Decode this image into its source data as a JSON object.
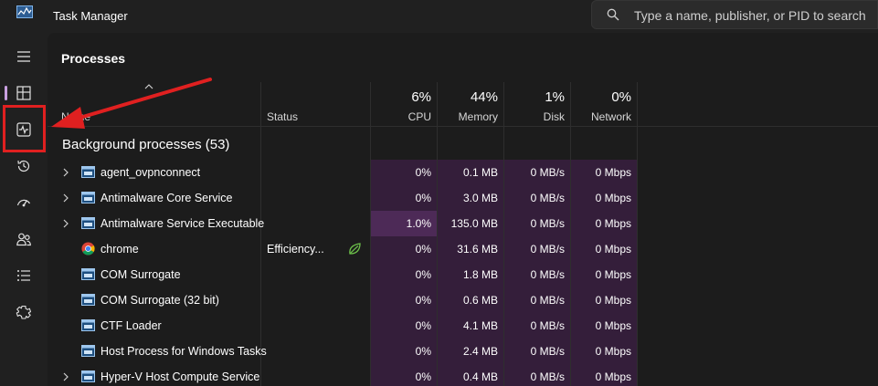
{
  "window": {
    "title": "Task Manager",
    "search_placeholder": "Type a name, publisher, or PID to search"
  },
  "sidebar": {
    "items": [
      {
        "icon": "hamburger-icon"
      },
      {
        "icon": "processes-icon",
        "active": true
      },
      {
        "icon": "performance-icon",
        "highlighted": true
      },
      {
        "icon": "app-history-icon"
      },
      {
        "icon": "startup-apps-icon"
      },
      {
        "icon": "users-icon"
      },
      {
        "icon": "details-icon"
      },
      {
        "icon": "services-icon"
      }
    ]
  },
  "page": {
    "title": "Processes"
  },
  "columns": {
    "name": "Name",
    "status": "Status",
    "cpu": {
      "pct": "6%",
      "label": "CPU"
    },
    "memory": {
      "pct": "44%",
      "label": "Memory"
    },
    "disk": {
      "pct": "1%",
      "label": "Disk"
    },
    "network": {
      "pct": "0%",
      "label": "Network"
    }
  },
  "group": {
    "title": "Background processes (53)"
  },
  "rows": [
    {
      "name": "agent_ovpnconnect",
      "status": "",
      "cpu": "0%",
      "memory": "0.1 MB",
      "disk": "0 MB/s",
      "network": "0 Mbps",
      "expandable": true,
      "icon": "window-icon"
    },
    {
      "name": "Antimalware Core Service",
      "status": "",
      "cpu": "0%",
      "memory": "3.0 MB",
      "disk": "0 MB/s",
      "network": "0 Mbps",
      "expandable": true,
      "icon": "window-icon"
    },
    {
      "name": "Antimalware Service Executable",
      "status": "",
      "cpu": "1.0%",
      "memory": "135.0 MB",
      "disk": "0 MB/s",
      "network": "0 Mbps",
      "expandable": true,
      "icon": "window-icon"
    },
    {
      "name": "chrome",
      "status": "Efficiency...",
      "cpu": "0%",
      "memory": "31.6 MB",
      "disk": "0 MB/s",
      "network": "0 Mbps",
      "expandable": false,
      "icon": "chrome-icon",
      "efficiency": true
    },
    {
      "name": "COM Surrogate",
      "status": "",
      "cpu": "0%",
      "memory": "1.8 MB",
      "disk": "0 MB/s",
      "network": "0 Mbps",
      "expandable": false,
      "icon": "window-icon"
    },
    {
      "name": "COM Surrogate (32 bit)",
      "status": "",
      "cpu": "0%",
      "memory": "0.6 MB",
      "disk": "0 MB/s",
      "network": "0 Mbps",
      "expandable": false,
      "icon": "window-icon"
    },
    {
      "name": "CTF Loader",
      "status": "",
      "cpu": "0%",
      "memory": "4.1 MB",
      "disk": "0 MB/s",
      "network": "0 Mbps",
      "expandable": false,
      "icon": "window-icon"
    },
    {
      "name": "Host Process for Windows Tasks",
      "status": "",
      "cpu": "0%",
      "memory": "2.4 MB",
      "disk": "0 MB/s",
      "network": "0 Mbps",
      "expandable": false,
      "icon": "window-icon"
    },
    {
      "name": "Hyper-V Host Compute Service",
      "status": "",
      "cpu": "0%",
      "memory": "0.4 MB",
      "disk": "0 MB/s",
      "network": "0 Mbps",
      "expandable": true,
      "icon": "window-icon"
    }
  ],
  "colors": {
    "background": "#202020",
    "panel": "#1c1c1c",
    "heat_low": "#341e3a",
    "heat_mid": "#4d2a57",
    "accent": "#c9a0e0",
    "annotation_red": "#e02020",
    "leaf_green": "#6cc04a"
  }
}
